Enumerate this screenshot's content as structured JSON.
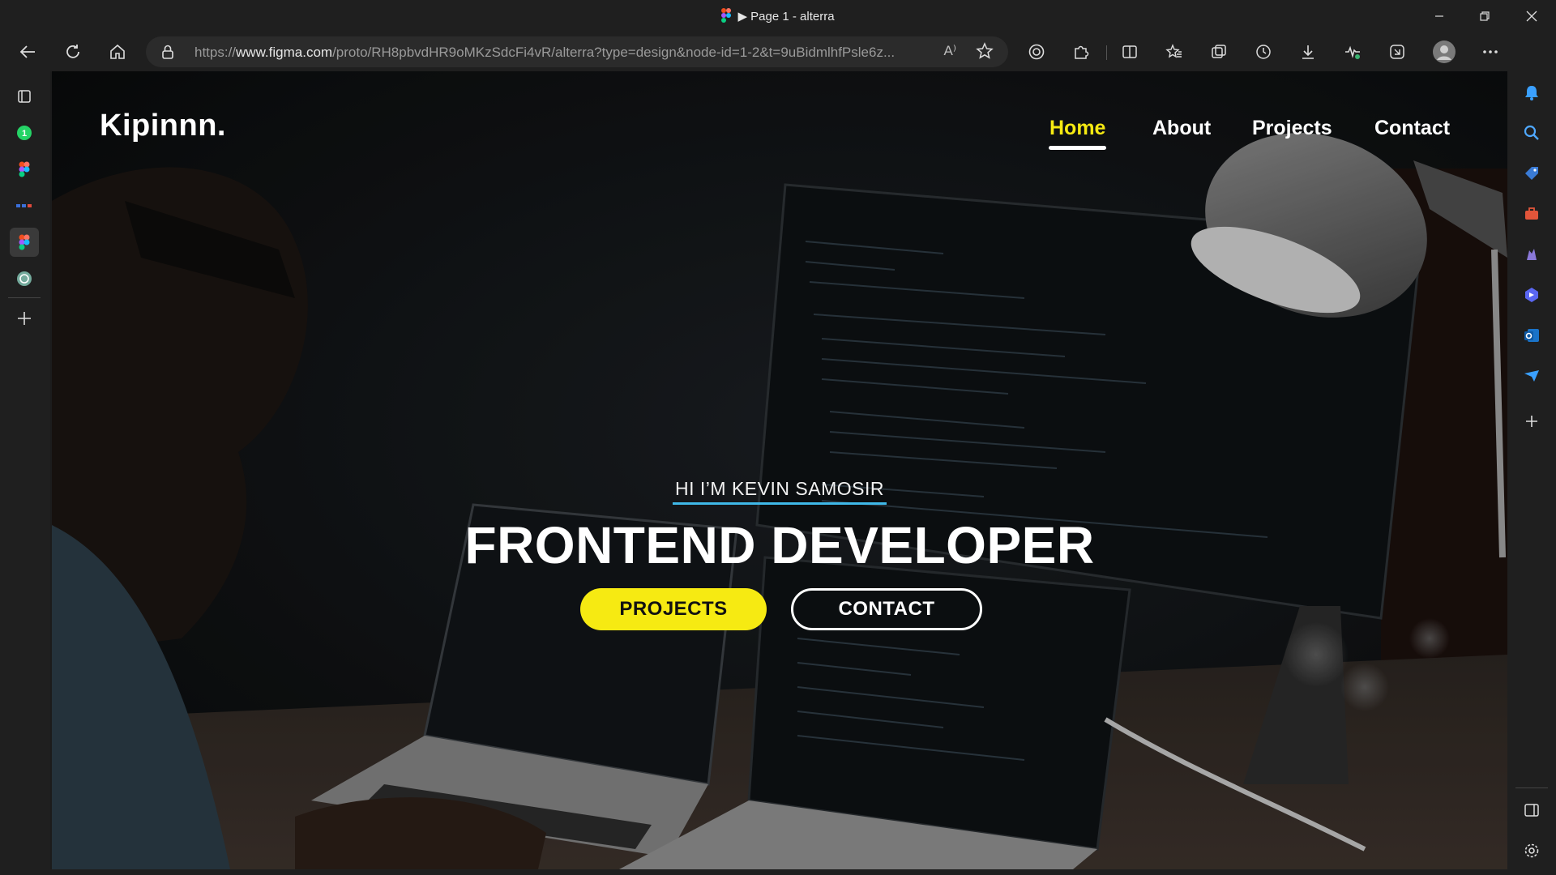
{
  "browser": {
    "window_title": "▶ Page 1 - alterra",
    "url_prefix": "https://",
    "url_host": "www.figma.com",
    "url_path": "/proto/RH8pbvdHR9oMKzSdcFi4vR/alterra?type=design&node-id=1-2&t=9uBidmlhfPsle6z...",
    "read_aloud_label": "A⁾",
    "toolbar_icons": [
      "back-icon",
      "refresh-icon",
      "home-icon",
      "lock-icon",
      "read-aloud-icon",
      "favorite-star-icon",
      "tracking-icon",
      "extensions-icon",
      "split-screen-icon",
      "favorites-icon",
      "collections-icon",
      "history-icon",
      "downloads-icon",
      "performance-icon",
      "copilot-screen-icon",
      "profile-avatar",
      "more-icon",
      "bing-icon"
    ],
    "left_sidebar_icons": [
      "tab-actions-icon",
      "whatsapp-icon",
      "figma-icon",
      "devtools-app-icon",
      "figma-active-icon",
      "chatgpt-icon",
      "add-icon"
    ],
    "right_sidebar_icons": [
      "notification-icon",
      "search-icon",
      "shopping-tag-icon",
      "tools-icon",
      "games-icon",
      "copilot-icon",
      "outlook-icon",
      "send-icon",
      "add-icon",
      "sidebar-toggle-icon",
      "settings-icon"
    ],
    "whatsapp_badge": "1"
  },
  "site": {
    "brand": "Kipinnn.",
    "nav": [
      {
        "label": "Home",
        "active": true
      },
      {
        "label": "About",
        "active": false
      },
      {
        "label": "Projects",
        "active": false
      },
      {
        "label": "Contact",
        "active": false
      }
    ],
    "greeting": "HI I’M KEVIN SAMOSIR",
    "headline": "FRONTEND DEVELOPER",
    "buttons": {
      "projects": "PROJECTS",
      "contact": "CONTACT"
    },
    "colors": {
      "accent": "#f6ea12",
      "underline": "#3fb8e8",
      "text": "#ffffff"
    }
  }
}
